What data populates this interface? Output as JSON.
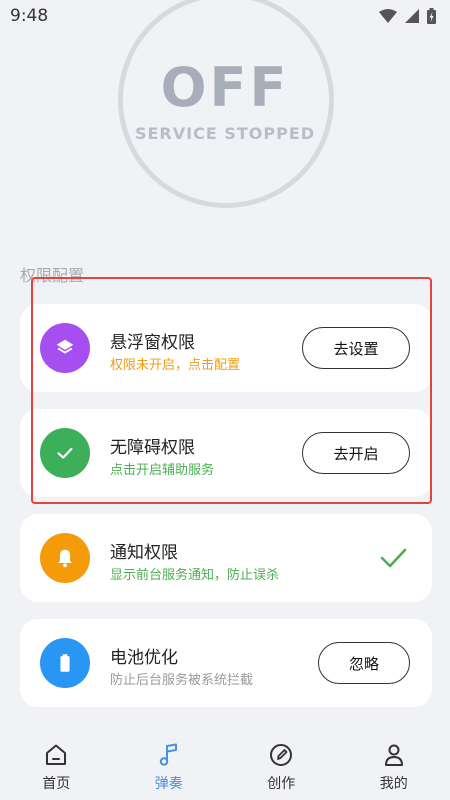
{
  "status_bar": {
    "time": "9:48"
  },
  "hero": {
    "state": "OFF",
    "subtitle": "SERVICE STOPPED"
  },
  "section": {
    "title": "权限配置"
  },
  "cards": [
    {
      "title": "悬浮窗权限",
      "subtitle": "权限未开启，点击配置",
      "subtitle_color": "#f39c12",
      "icon_color": "#a64ff0",
      "action": "去设置"
    },
    {
      "title": "无障碍权限",
      "subtitle": "点击开启辅助服务",
      "subtitle_color": "#4caf50",
      "icon_color": "#3dae5a",
      "action": "去开启"
    },
    {
      "title": "通知权限",
      "subtitle": "显示前台服务通知，防止误杀",
      "subtitle_color": "#4caf50",
      "icon_color": "#f59b0a"
    },
    {
      "title": "电池优化",
      "subtitle": "防止后台服务被系统拦截",
      "subtitle_color": "#9a9a9a",
      "icon_color": "#2a96f3",
      "action": "忽略"
    }
  ],
  "nav": {
    "items": [
      {
        "label": "首页"
      },
      {
        "label": "弹奏"
      },
      {
        "label": "创作"
      },
      {
        "label": "我的"
      }
    ],
    "active_color": "#4a90e2"
  }
}
